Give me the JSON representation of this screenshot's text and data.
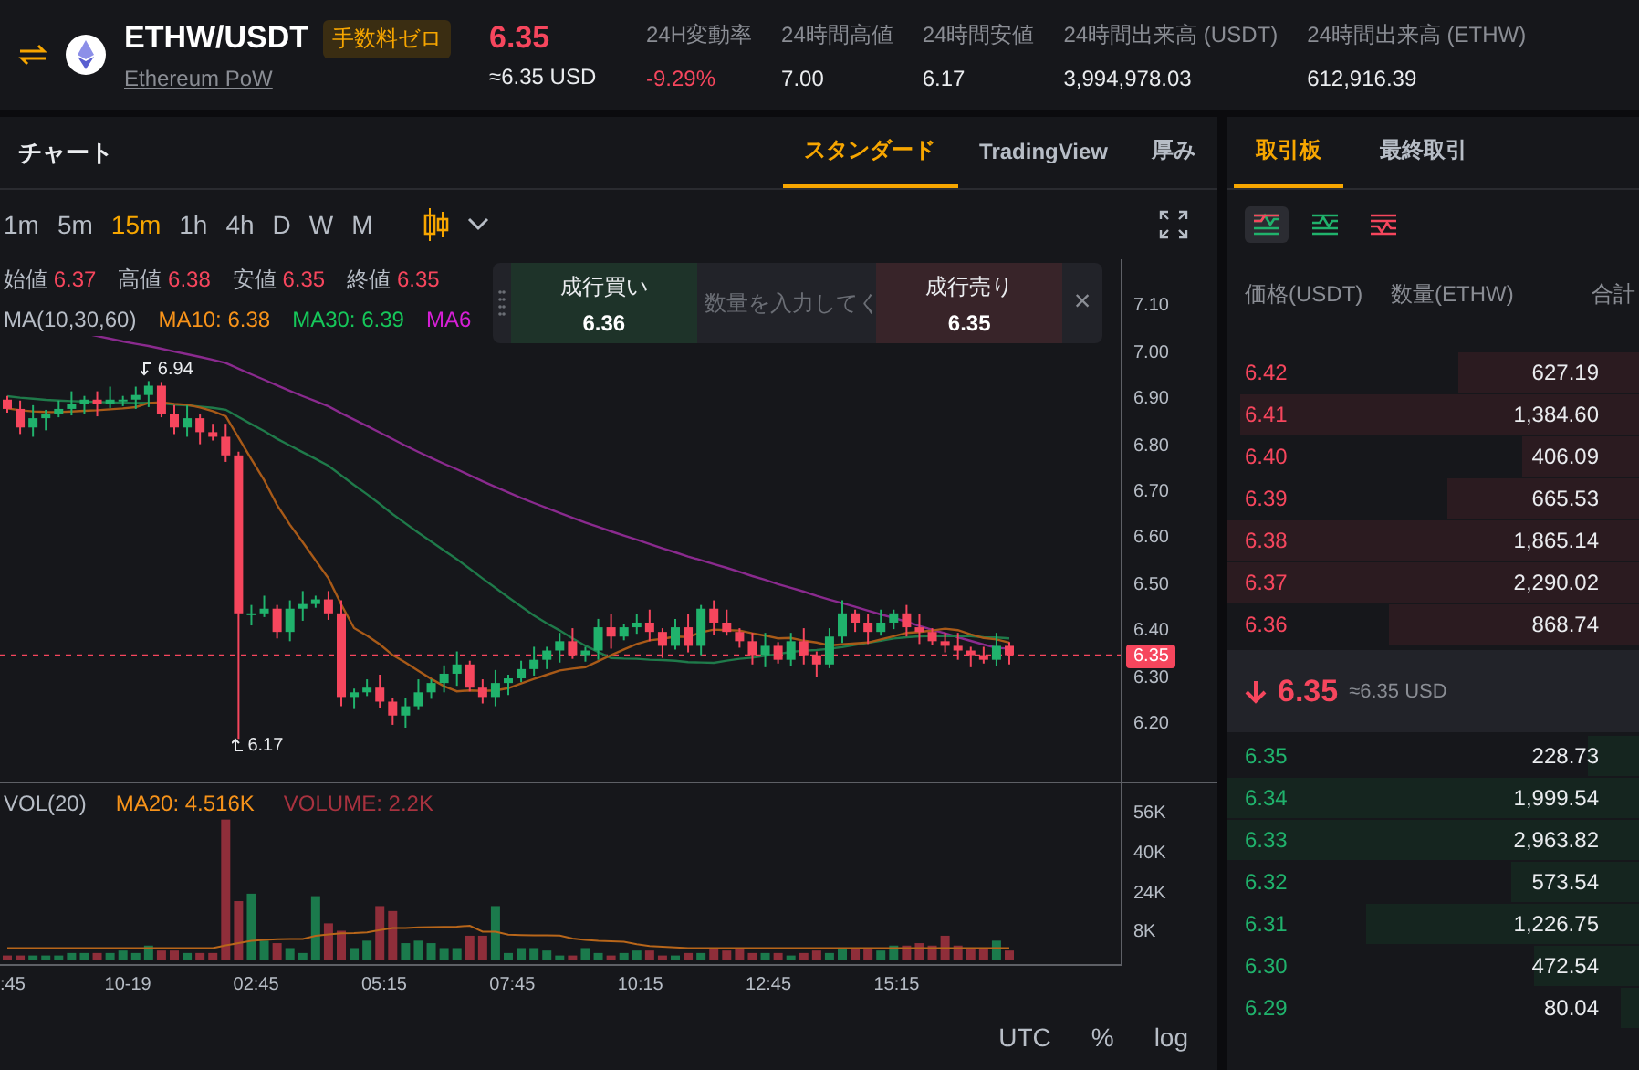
{
  "header": {
    "pair": "ETHW/USDT",
    "badge": "手数料ゼロ",
    "name": "Ethereum PoW",
    "price": "6.35",
    "price_usd": "≈6.35 USD",
    "stats": [
      {
        "label": "24H変動率",
        "value": "-9.29%",
        "kind": "down"
      },
      {
        "label": "24時間高値",
        "value": "7.00",
        "kind": "plain"
      },
      {
        "label": "24時間安値",
        "value": "6.17",
        "kind": "plain"
      },
      {
        "label": "24時間出来高 (USDT)",
        "value": "3,994,978.03",
        "kind": "plain"
      },
      {
        "label": "24時間出来高 (ETHW)",
        "value": "612,916.39",
        "kind": "plain"
      }
    ]
  },
  "chart_panel": {
    "title": "チャート",
    "tabs": [
      {
        "label": "スタンダード",
        "selected": true
      },
      {
        "label": "TradingView",
        "selected": false
      },
      {
        "label": "厚み",
        "selected": false
      }
    ],
    "intervals": [
      {
        "label": "1m",
        "selected": false
      },
      {
        "label": "5m",
        "selected": false
      },
      {
        "label": "15m",
        "selected": true
      },
      {
        "label": "1h",
        "selected": false
      },
      {
        "label": "4h",
        "selected": false
      },
      {
        "label": "D",
        "selected": false
      },
      {
        "label": "W",
        "selected": false
      },
      {
        "label": "M",
        "selected": false
      }
    ],
    "ohlc": [
      {
        "label": "始値",
        "value": "6.37"
      },
      {
        "label": "高値",
        "value": "6.38"
      },
      {
        "label": "安値",
        "value": "6.35"
      },
      {
        "label": "終値",
        "value": "6.35"
      }
    ],
    "ma_label": "MA(10,30,60)",
    "mas": [
      {
        "label": "MA10: 6.38",
        "color": "#f7931a"
      },
      {
        "label": "MA30: 6.39",
        "color": "#16c75a"
      },
      {
        "label": "MA6",
        "color": "#d61fd6"
      }
    ],
    "quick_trade": {
      "buy_label": "成行買い",
      "buy_price": "6.36",
      "placeholder": "数量を入力してく",
      "sell_label": "成行売り",
      "sell_price": "6.35",
      "close": "×"
    },
    "price_ticks": [
      "7.10",
      "7.00",
      "6.90",
      "6.80",
      "6.70",
      "6.60",
      "6.50",
      "6.40",
      "6.30",
      "6.20"
    ],
    "last_price_tag": "6.35",
    "high_mark": "6.94",
    "low_mark": "6.17",
    "volume": {
      "label": "VOL(20)",
      "ma": "MA20: 4.516K",
      "current": "VOLUME: 2.2K",
      "ticks": [
        "56K",
        "40K",
        "24K",
        "8K"
      ]
    },
    "time_ticks": [
      ":45",
      "10-19",
      "02:45",
      "05:15",
      "07:45",
      "10:15",
      "12:45",
      "15:15"
    ],
    "footer": [
      "UTC",
      "%",
      "log"
    ]
  },
  "order_book": {
    "tabs": [
      {
        "label": "取引板",
        "selected": true
      },
      {
        "label": "最終取引",
        "selected": false
      }
    ],
    "views": [
      {
        "kind": "both",
        "selected": true
      },
      {
        "kind": "bids",
        "selected": false
      },
      {
        "kind": "asks",
        "selected": false
      }
    ],
    "columns": [
      "価格(USDT)",
      "数量(ETHW)",
      "合計"
    ],
    "asks": [
      {
        "price": "6.42",
        "amount": "627.19"
      },
      {
        "price": "6.41",
        "amount": "1,384.60"
      },
      {
        "price": "6.40",
        "amount": "406.09"
      },
      {
        "price": "6.39",
        "amount": "665.53"
      },
      {
        "price": "6.38",
        "amount": "1,865.14"
      },
      {
        "price": "6.37",
        "amount": "2,290.02"
      },
      {
        "price": "6.36",
        "amount": "868.74"
      }
    ],
    "last_price": {
      "value": "6.35",
      "usd": "≈6.35 USD"
    },
    "bids": [
      {
        "price": "6.35",
        "amount": "228.73"
      },
      {
        "price": "6.34",
        "amount": "1,999.54"
      },
      {
        "price": "6.33",
        "amount": "2,963.82"
      },
      {
        "price": "6.32",
        "amount": "573.54"
      },
      {
        "price": "6.31",
        "amount": "1,226.75"
      },
      {
        "price": "6.30",
        "amount": "472.54"
      },
      {
        "price": "6.29",
        "amount": "80.04"
      }
    ]
  }
}
